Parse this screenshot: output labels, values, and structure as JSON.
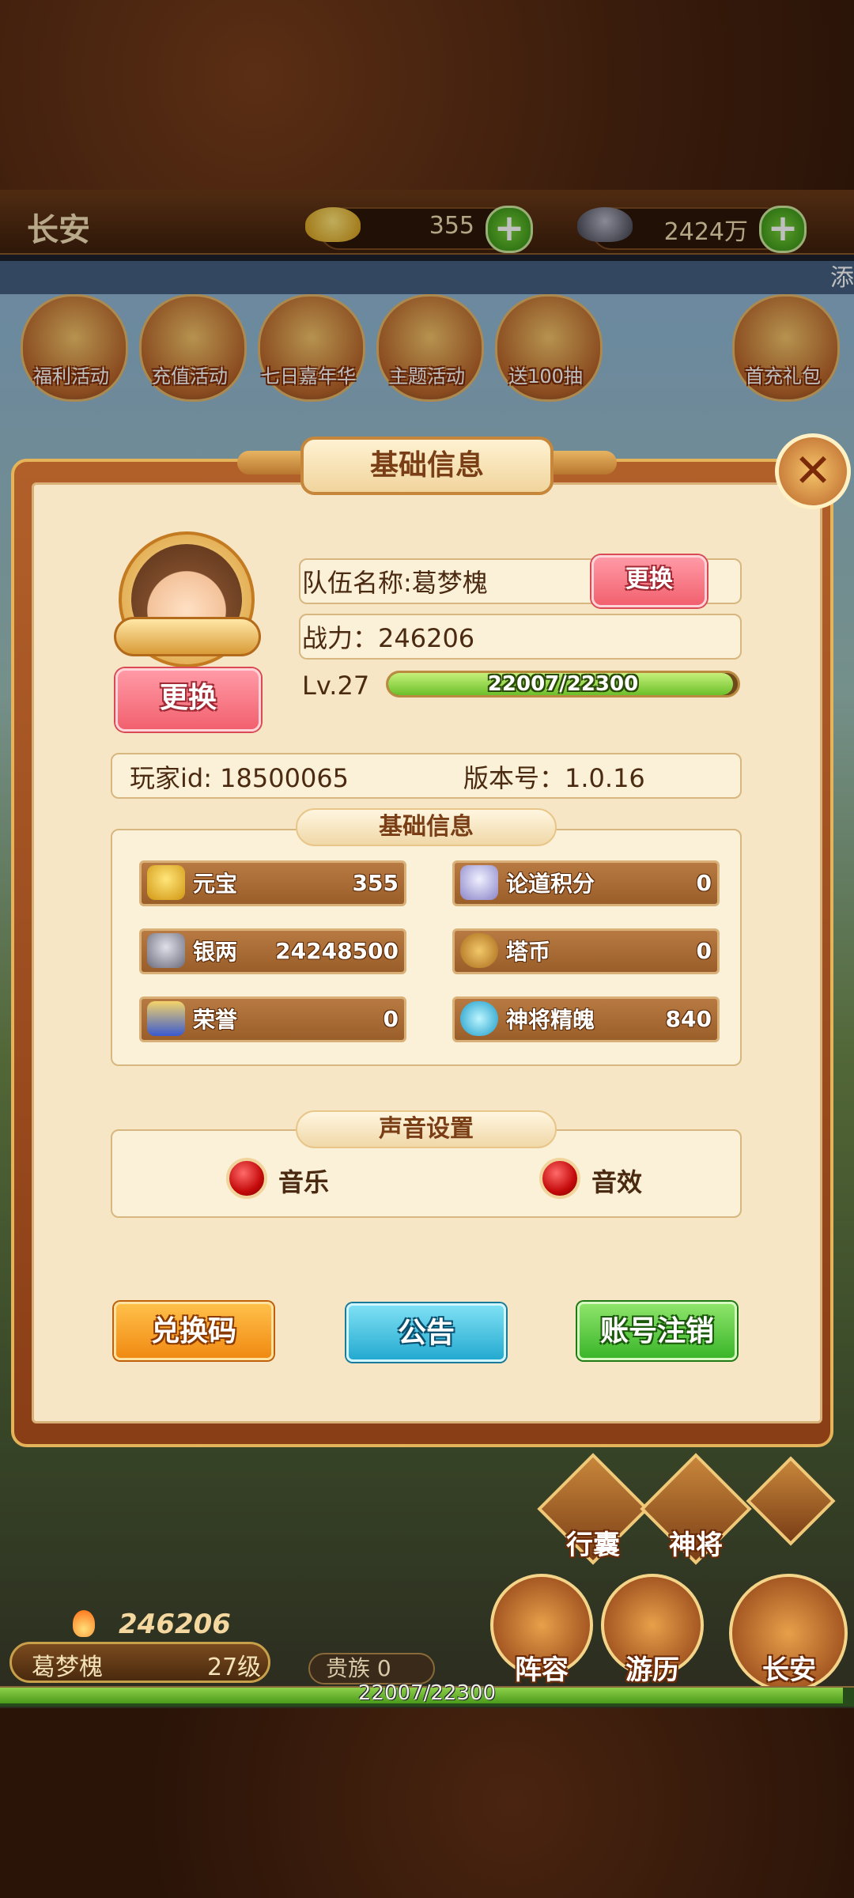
{
  "top_bar": {
    "city": "长安",
    "gold_value": "355",
    "silver_value": "2424万",
    "ticker_text": "添"
  },
  "activities": [
    {
      "label": "福利活动"
    },
    {
      "label": "充值活动"
    },
    {
      "label": "七日嘉年华"
    },
    {
      "label": "主题活动"
    },
    {
      "label": "送100抽"
    },
    {
      "label": "首充礼包"
    }
  ],
  "dialog": {
    "title": "基础信息",
    "close_symbol": "✕",
    "avatar_change_label": "更换",
    "team_name": "队伍名称:葛梦槐",
    "team_change_label": "更换",
    "power_text": "战力：246206",
    "level_text": "Lv.27",
    "exp_text": "22007/22300",
    "exp_fraction": 0.987,
    "player_id_text": "玩家id: 18500065",
    "version_text": "版本号：1.0.16",
    "resources_section_title": "基础信息",
    "resources": [
      {
        "name": "元宝",
        "value": "355",
        "icon": "gold-ingot-icon"
      },
      {
        "name": "论道积分",
        "value": "0",
        "icon": "scroll-icon"
      },
      {
        "name": "银两",
        "value": "24248500",
        "icon": "silver-ingot-icon"
      },
      {
        "name": "塔币",
        "value": "0",
        "icon": "coin-icon"
      },
      {
        "name": "荣誉",
        "value": "0",
        "icon": "honor-token-icon"
      },
      {
        "name": "神将精魄",
        "value": "840",
        "icon": "soul-crystal-icon"
      }
    ],
    "sound_section_title": "声音设置",
    "sound_music_label": "音乐",
    "sound_effect_label": "音效",
    "buttons": {
      "redeem": "兑换码",
      "notice": "公告",
      "logout": "账号注销"
    }
  },
  "hud": {
    "power": "246206",
    "name": "葛梦槐",
    "level": "27级",
    "noble": "贵族  0",
    "exp": "22007/22300",
    "nav": {
      "bag": "行囊",
      "generals": "神将",
      "lineup": "阵容",
      "travel": "游历",
      "city": "长安"
    }
  },
  "colors": {
    "panel": "#f6e6c6",
    "frame": "#b2602a",
    "accent_pink": "#f2606e",
    "accent_orange": "#f08a12",
    "accent_blue": "#24aad0",
    "accent_green": "#3ab62a"
  }
}
